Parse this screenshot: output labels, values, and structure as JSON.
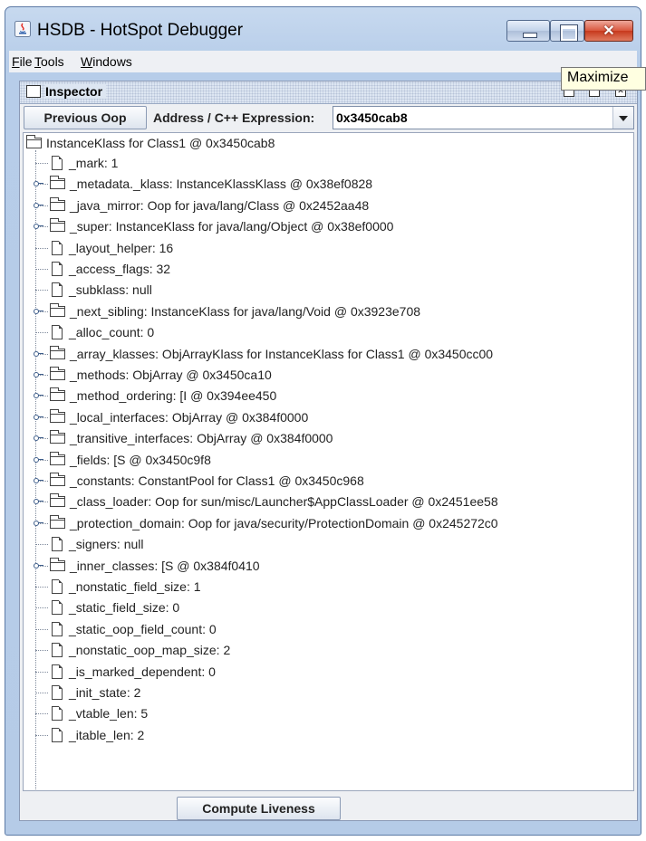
{
  "window": {
    "title": "HSDB - HotSpot Debugger",
    "close_glyph": "✕"
  },
  "menu": {
    "file": {
      "mnemonic": "F",
      "rest": "ile"
    },
    "tools": {
      "mnemonic": "T",
      "rest": "ools"
    },
    "windows": {
      "mnemonic": "W",
      "rest": "indows"
    }
  },
  "tooltip": "Maximize",
  "inspector": {
    "title": "Inspector",
    "previous_button": "Previous Oop",
    "address_label": "Address / C++ Expression:",
    "address_value": "0x3450cab8",
    "compute_button": "Compute Liveness"
  },
  "tree": {
    "root": "InstanceKlass for Class1 @ 0x3450cab8",
    "children": [
      {
        "text": "_mark: 1",
        "kind": "file"
      },
      {
        "text": "_metadata._klass: InstanceKlassKlass @ 0x38ef0828",
        "kind": "folder"
      },
      {
        "text": "_java_mirror: Oop for java/lang/Class @ 0x2452aa48",
        "kind": "folder"
      },
      {
        "text": "_super: InstanceKlass for java/lang/Object @ 0x38ef0000",
        "kind": "folder"
      },
      {
        "text": "_layout_helper: 16",
        "kind": "file"
      },
      {
        "text": "_access_flags: 32",
        "kind": "file"
      },
      {
        "text": "_subklass: null",
        "kind": "file"
      },
      {
        "text": "_next_sibling: InstanceKlass for java/lang/Void @ 0x3923e708",
        "kind": "folder"
      },
      {
        "text": "_alloc_count: 0",
        "kind": "file"
      },
      {
        "text": "_array_klasses: ObjArrayKlass for InstanceKlass for Class1 @ 0x3450cc00",
        "kind": "folder"
      },
      {
        "text": "_methods: ObjArray @ 0x3450ca10",
        "kind": "folder"
      },
      {
        "text": "_method_ordering: [I @ 0x394ee450",
        "kind": "folder"
      },
      {
        "text": "_local_interfaces: ObjArray @ 0x384f0000",
        "kind": "folder"
      },
      {
        "text": "_transitive_interfaces: ObjArray @ 0x384f0000",
        "kind": "folder"
      },
      {
        "text": "_fields: [S @ 0x3450c9f8",
        "kind": "folder"
      },
      {
        "text": "_constants: ConstantPool for Class1 @ 0x3450c968",
        "kind": "folder"
      },
      {
        "text": "_class_loader: Oop for sun/misc/Launcher$AppClassLoader @ 0x2451ee58",
        "kind": "folder"
      },
      {
        "text": "_protection_domain: Oop for java/security/ProtectionDomain @ 0x245272c0",
        "kind": "folder"
      },
      {
        "text": "_signers: null",
        "kind": "file"
      },
      {
        "text": "_inner_classes: [S @ 0x384f0410",
        "kind": "folder"
      },
      {
        "text": "_nonstatic_field_size: 1",
        "kind": "file"
      },
      {
        "text": "_static_field_size: 0",
        "kind": "file"
      },
      {
        "text": "_static_oop_field_count: 0",
        "kind": "file"
      },
      {
        "text": "_nonstatic_oop_map_size: 2",
        "kind": "file"
      },
      {
        "text": "_is_marked_dependent: 0",
        "kind": "file"
      },
      {
        "text": "_init_state: 2",
        "kind": "file"
      },
      {
        "text": "_vtable_len: 5",
        "kind": "file"
      },
      {
        "text": "_itable_len: 2",
        "kind": "file"
      }
    ]
  }
}
